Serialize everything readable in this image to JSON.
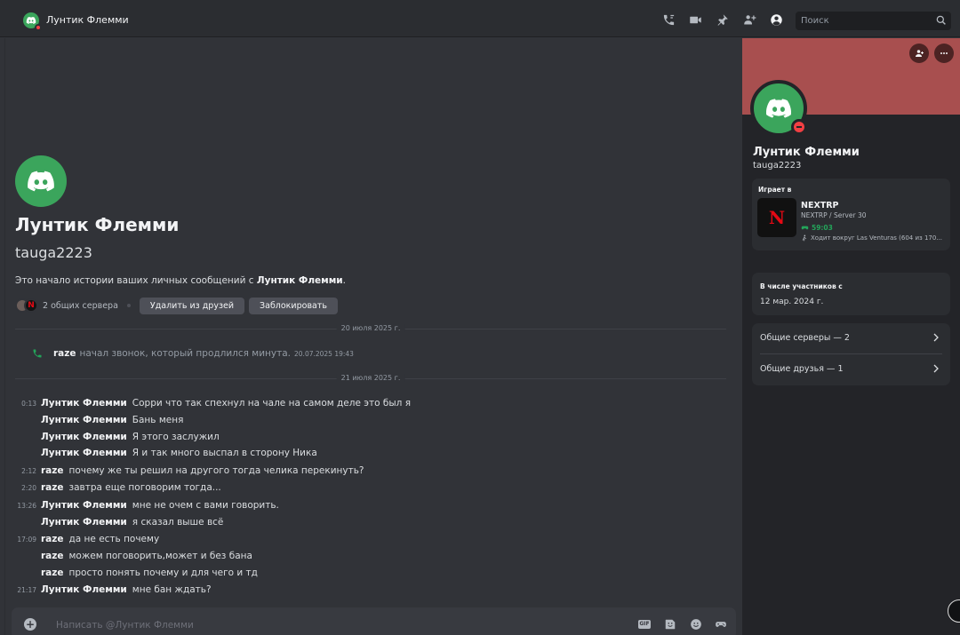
{
  "header": {
    "channel_name": "Лунтик Флемми",
    "search_placeholder": "Поиск"
  },
  "intro": {
    "display_name": "Лунтик Флемми",
    "username": "tauga2223",
    "text_prefix": "Это начало истории ваших личных сообщений с ",
    "text_name": "Лунтик Флемми",
    "text_suffix": ".",
    "mutual_servers": "2 общих сервера",
    "remove_friend": "Удалить из друзей",
    "block": "Заблокировать"
  },
  "dividers": [
    "20 июля 2025 г.",
    "21 июля 2025 г."
  ],
  "call": {
    "author": "raze",
    "text": "начал звонок, который продлился минута.",
    "timestamp": "20.07.2025 19:43"
  },
  "messages": [
    {
      "time": "0:13",
      "author": "Лунтик Флемми",
      "text": "Сорри что так спехнул на чале на самом деле это был я"
    },
    {
      "time": "",
      "author": "Лунтик Флемми",
      "text": "Бань меня"
    },
    {
      "time": "",
      "author": "Лунтик Флемми",
      "text": "Я этого заслужил"
    },
    {
      "time": "",
      "author": "Лунтик Флемми",
      "text": "Я и так много выспал в сторону Ника"
    },
    {
      "time": "2:12",
      "author": "raze",
      "text": "почему же ты решил на другого тогда челика перекинуть?"
    },
    {
      "time": "2:20",
      "author": "raze",
      "text": "завтра еще поговорим тогда..."
    },
    {
      "time": "13:26",
      "author": "Лунтик Флемми",
      "text": "мне не очем с вами говорить."
    },
    {
      "time": "",
      "author": "Лунтик Флемми",
      "text": "я сказал выше всё"
    },
    {
      "time": "17:09",
      "author": "raze",
      "text": "да не есть почему"
    },
    {
      "time": "",
      "author": "raze",
      "text": "можем поговорить,может и без бана"
    },
    {
      "time": "",
      "author": "raze",
      "text": "просто понять почему и для чего и тд"
    },
    {
      "time": "21:17",
      "author": "Лунтик Флемми",
      "text": "мне бан ждать?"
    }
  ],
  "composer": {
    "placeholder": "Написать @Лунтик Флемми",
    "gif_label": "GIF"
  },
  "profile": {
    "display_name": "Лунтик Флемми",
    "username": "tauga2223",
    "banner_color": "#a84f4f",
    "activity": {
      "label": "Играет в",
      "game_logo_letter": "N",
      "title": "NEXTRP",
      "subtitle": "NEXTRP / Server 30",
      "elapsed": "59:03",
      "state": "Ходит вокруг Las Venturas (604 из 170..."
    },
    "member_since": {
      "label": "В числе участников с",
      "value": "12 мар. 2024 г."
    },
    "mutual_servers": "Общие серверы — 2",
    "mutual_friends": "Общие друзья — 1"
  },
  "colors": {
    "online_green": "#3ba55c",
    "dnd_red": "#f23f43",
    "background": "#313338"
  }
}
